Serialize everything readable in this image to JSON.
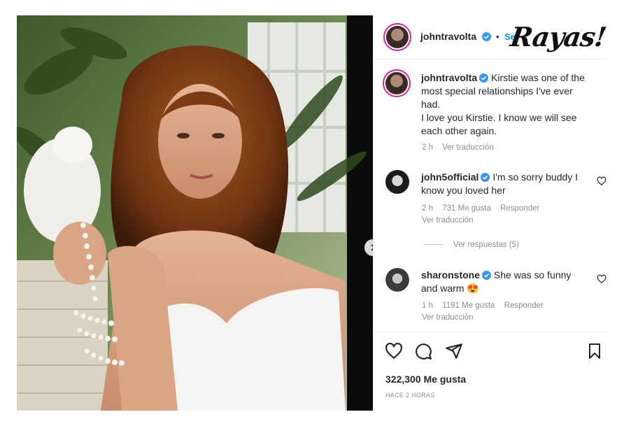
{
  "watermark": "Rayas!",
  "post": {
    "author": "johntravolta",
    "follow_label": "Se",
    "separator": "•"
  },
  "caption": {
    "username": "johntravolta",
    "text_1": "Kirstie was one of the",
    "text_2": "most special relationships I've ever",
    "text_3": "had.",
    "text_4": "I love you Kirstie. I know we will see",
    "text_5": "each other again.",
    "time": "2 h",
    "translate": "Ver traducción"
  },
  "comments": [
    {
      "username": "john5official",
      "text_1": "I'm so sorry buddy I",
      "text_2": "know you loved her",
      "time": "2 h",
      "likes": "731 Me gusta",
      "reply": "Responder",
      "translate": "Ver traducción"
    },
    {
      "username": "sharonstone",
      "text_1": "She was so funny",
      "text_2": "and warm 😍",
      "time": "1 h",
      "likes": "1191 Me gusta",
      "reply": "Responder",
      "translate": "Ver traducción"
    }
  ],
  "view_replies": "Ver respuestas (5)",
  "likes_count": "322,300 Me gusta",
  "posted_time": "HACE 2 HORAS",
  "colors": {
    "accent": "#0095f6",
    "verified": "#3897f0",
    "ring": "#d6249f"
  },
  "icons": [
    "heart-icon",
    "comment-icon",
    "share-icon",
    "bookmark-icon",
    "chevron-right-icon",
    "verified-icon"
  ]
}
